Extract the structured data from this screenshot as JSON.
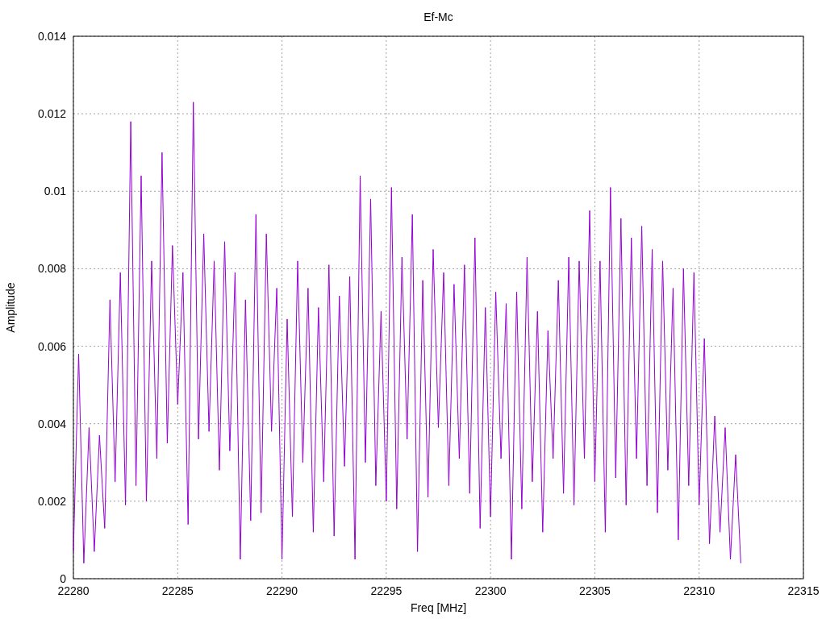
{
  "chart_data": {
    "type": "line",
    "title": "Ef-Mc",
    "xlabel": "Freq [MHz]",
    "ylabel": "Amplitude",
    "xlim": [
      22280,
      22315
    ],
    "ylim": [
      0,
      0.014
    ],
    "xticks": [
      22280,
      22285,
      22290,
      22295,
      22300,
      22305,
      22310,
      22315
    ],
    "yticks": [
      0,
      0.002,
      0.004,
      0.006,
      0.008,
      0.01,
      0.012,
      0.014
    ],
    "x": [
      22280,
      22280.25,
      22280.5,
      22280.75,
      22281,
      22281.25,
      22281.5,
      22281.75,
      22282,
      22282.25,
      22282.5,
      22282.75,
      22283,
      22283.25,
      22283.5,
      22283.75,
      22284,
      22284.25,
      22284.5,
      22284.75,
      22285,
      22285.25,
      22285.5,
      22285.75,
      22286,
      22286.25,
      22286.5,
      22286.75,
      22287,
      22287.25,
      22287.5,
      22287.75,
      22288,
      22288.25,
      22288.5,
      22288.75,
      22289,
      22289.25,
      22289.5,
      22289.75,
      22290,
      22290.25,
      22290.5,
      22290.75,
      22291,
      22291.25,
      22291.5,
      22291.75,
      22292,
      22292.25,
      22292.5,
      22292.75,
      22293,
      22293.25,
      22293.5,
      22293.75,
      22294,
      22294.25,
      22294.5,
      22294.75,
      22295,
      22295.25,
      22295.5,
      22295.75,
      22296,
      22296.25,
      22296.5,
      22296.75,
      22297,
      22297.25,
      22297.5,
      22297.75,
      22298,
      22298.25,
      22298.5,
      22298.75,
      22299,
      22299.25,
      22299.5,
      22299.75,
      22300,
      22300.25,
      22300.5,
      22300.75,
      22301,
      22301.25,
      22301.5,
      22301.75,
      22302,
      22302.25,
      22302.5,
      22302.75,
      22303,
      22303.25,
      22303.5,
      22303.75,
      22304,
      22304.25,
      22304.5,
      22304.75,
      22305,
      22305.25,
      22305.5,
      22305.75,
      22306,
      22306.25,
      22306.5,
      22306.75,
      22307,
      22307.25,
      22307.5,
      22307.75,
      22308,
      22308.25,
      22308.5,
      22308.75,
      22309,
      22309.25,
      22309.5,
      22309.75,
      22310,
      22310.25,
      22310.5,
      22310.75,
      22311,
      22311.25,
      22311.5,
      22311.75,
      22312
    ],
    "grid": true,
    "series": [
      {
        "color": "#9400d3",
        "values": [
          0.0007,
          0.0058,
          0.0004,
          0.0039,
          0.0007,
          0.0037,
          0.0013,
          0.0072,
          0.0025,
          0.0079,
          0.0019,
          0.0118,
          0.0024,
          0.0104,
          0.002,
          0.0082,
          0.0031,
          0.011,
          0.0035,
          0.0086,
          0.0045,
          0.0079,
          0.0014,
          0.0123,
          0.0036,
          0.0089,
          0.0038,
          0.0082,
          0.0028,
          0.0087,
          0.0033,
          0.0079,
          0.0005,
          0.0072,
          0.0015,
          0.0094,
          0.0017,
          0.0089,
          0.0038,
          0.0075,
          0.0005,
          0.0067,
          0.0016,
          0.0082,
          0.003,
          0.0075,
          0.0012,
          0.007,
          0.0025,
          0.0081,
          0.0011,
          0.0073,
          0.0029,
          0.0078,
          0.0005,
          0.0104,
          0.003,
          0.0098,
          0.0024,
          0.0069,
          0.002,
          0.0101,
          0.0018,
          0.0083,
          0.0036,
          0.0094,
          0.0007,
          0.0077,
          0.0021,
          0.0085,
          0.0039,
          0.0079,
          0.0024,
          0.0076,
          0.0031,
          0.0081,
          0.0022,
          0.0088,
          0.0013,
          0.007,
          0.0016,
          0.0074,
          0.0031,
          0.0071,
          0.0005,
          0.0074,
          0.0018,
          0.0083,
          0.0025,
          0.0069,
          0.0012,
          0.0064,
          0.0031,
          0.0077,
          0.0022,
          0.0083,
          0.0019,
          0.0082,
          0.0031,
          0.0095,
          0.0025,
          0.0082,
          0.0012,
          0.0101,
          0.0026,
          0.0093,
          0.0019,
          0.0088,
          0.0031,
          0.0091,
          0.0024,
          0.0085,
          0.0017,
          0.0082,
          0.0028,
          0.0075,
          0.001,
          0.008,
          0.0024,
          0.0079,
          0.0019,
          0.0062,
          0.0009,
          0.0042,
          0.0012,
          0.0039,
          0.0005,
          0.0032,
          0.0004
        ]
      }
    ]
  }
}
